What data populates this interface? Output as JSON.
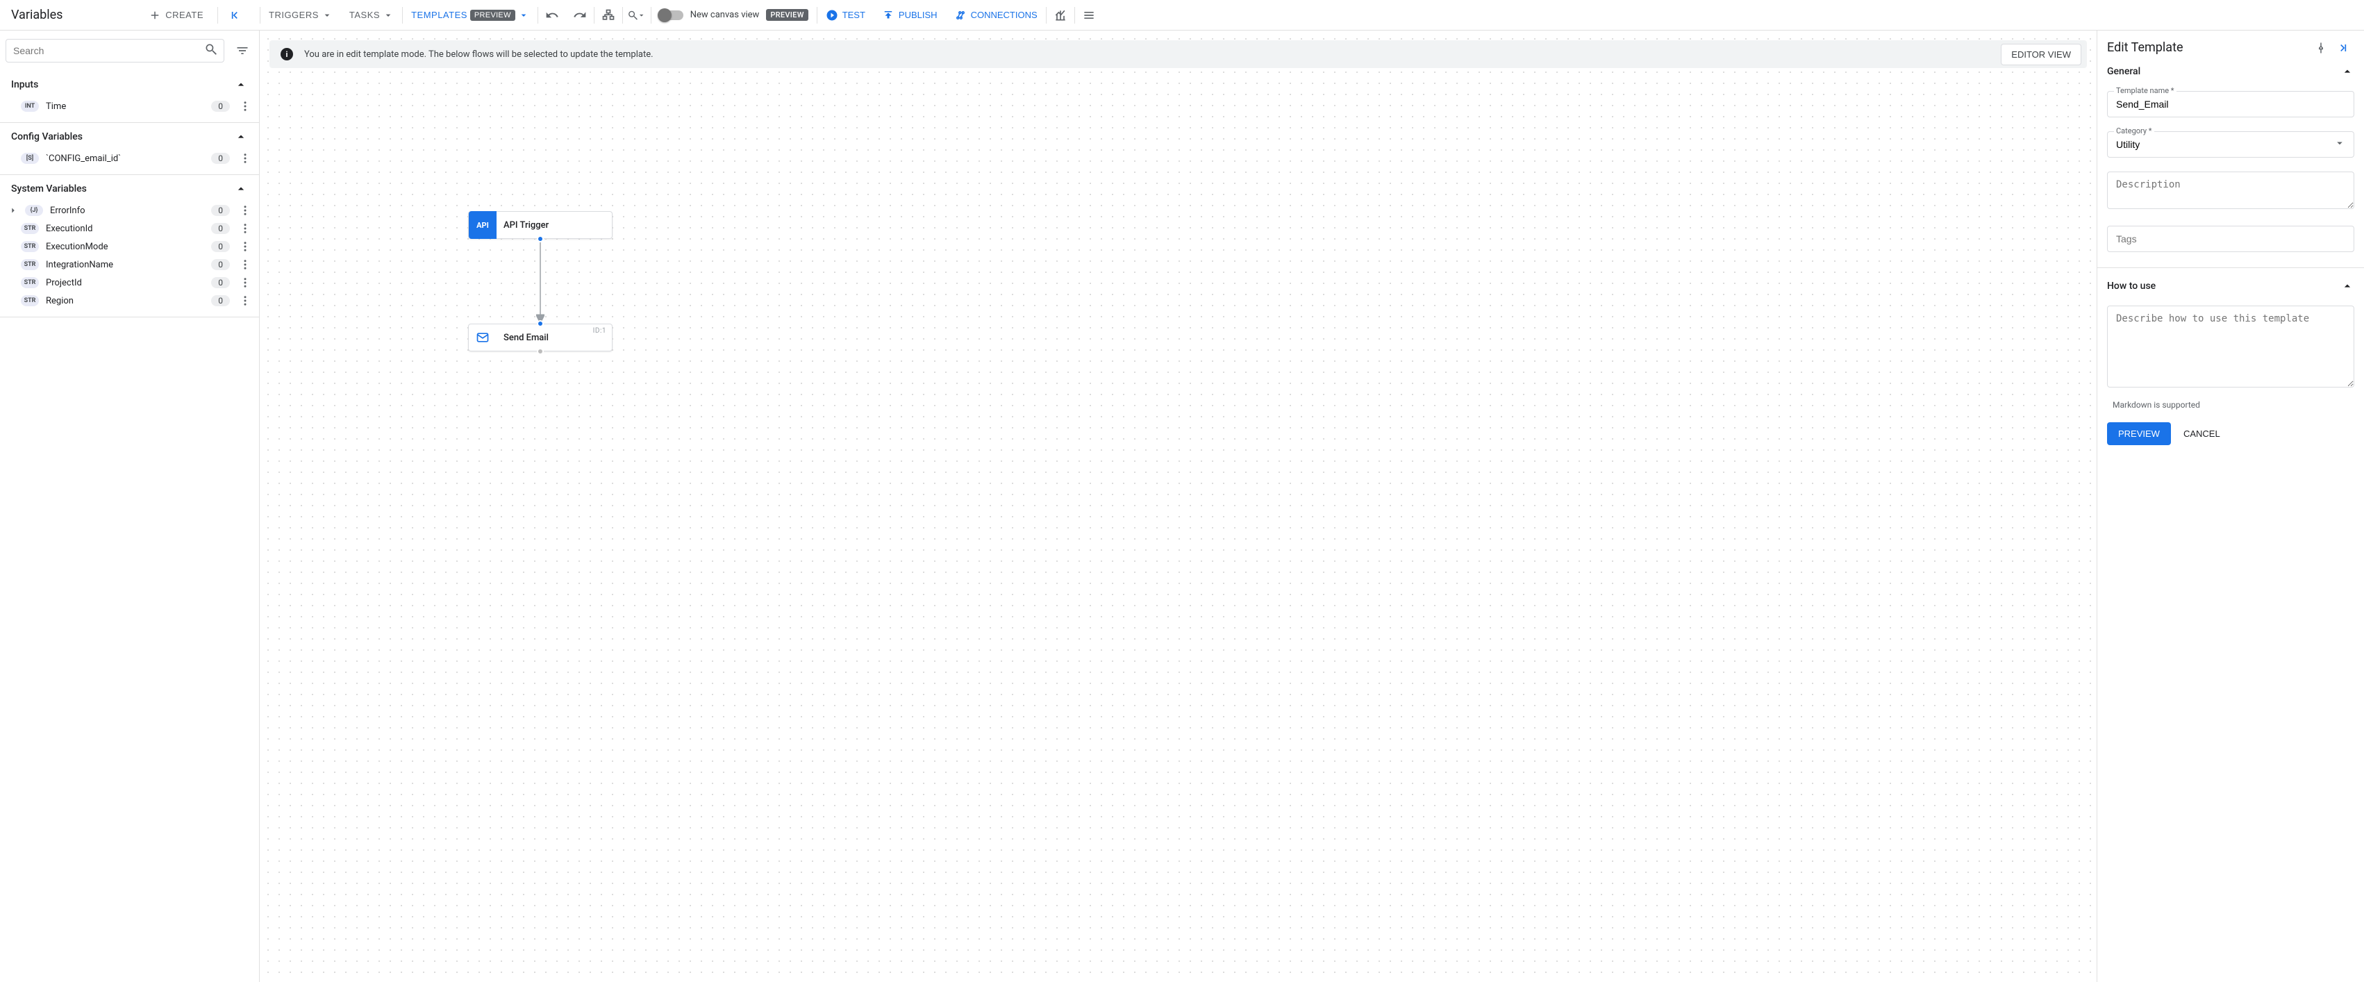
{
  "left": {
    "title": "Variables",
    "create": "CREATE",
    "search_placeholder": "Search",
    "sections": {
      "inputs": {
        "label": "Inputs",
        "items": [
          {
            "type": "INT",
            "name": "Time",
            "count": "0"
          }
        ]
      },
      "config": {
        "label": "Config Variables",
        "items": [
          {
            "type": "[S]",
            "name": "`CONFIG_email_id`",
            "count": "0"
          }
        ]
      },
      "system": {
        "label": "System Variables",
        "items": [
          {
            "type": "{J}",
            "name": "ErrorInfo",
            "count": "0",
            "expandable": true
          },
          {
            "type": "STR",
            "name": "ExecutionId",
            "count": "0"
          },
          {
            "type": "STR",
            "name": "ExecutionMode",
            "count": "0"
          },
          {
            "type": "STR",
            "name": "IntegrationName",
            "count": "0"
          },
          {
            "type": "STR",
            "name": "ProjectId",
            "count": "0"
          },
          {
            "type": "STR",
            "name": "Region",
            "count": "0"
          }
        ]
      }
    }
  },
  "toolbar": {
    "triggers": "TRIGGERS",
    "tasks": "TASKS",
    "templates": "TEMPLATES",
    "templates_badge": "PREVIEW",
    "new_canvas": "New canvas view",
    "new_canvas_badge": "PREVIEW",
    "test": "TEST",
    "publish": "PUBLISH",
    "connections": "CONNECTIONS"
  },
  "canvas": {
    "banner_text": "You are in edit template mode. The below flows will be selected to update the template.",
    "editor_view": "EDITOR VIEW",
    "nodes": {
      "api": {
        "label": "API Trigger",
        "icon_text": "API"
      },
      "mail": {
        "label": "Send Email",
        "id_label": "ID:1"
      }
    }
  },
  "right": {
    "title": "Edit Template",
    "general": {
      "label": "General",
      "name_label": "Template name *",
      "name_value": "Send_Email",
      "category_label": "Category *",
      "category_value": "Utility",
      "description_placeholder": "Description",
      "tags_placeholder": "Tags"
    },
    "how": {
      "label": "How to use",
      "placeholder": "Describe how to use this template",
      "helper": "Markdown is supported"
    },
    "preview_btn": "PREVIEW",
    "cancel_btn": "CANCEL"
  }
}
